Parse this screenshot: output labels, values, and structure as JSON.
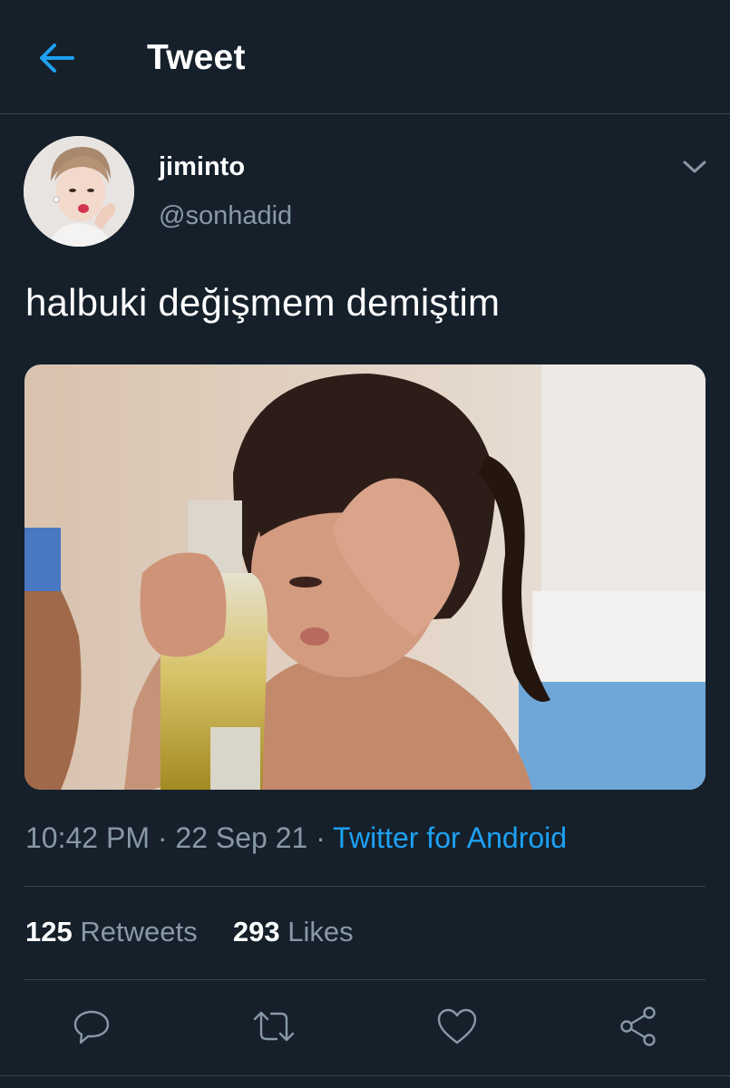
{
  "header": {
    "title": "Tweet",
    "back_icon": "arrow-left-icon",
    "accent_color": "#1da1f2"
  },
  "author": {
    "display_name": "jiminto",
    "handle": "@sonhadid"
  },
  "tweet": {
    "text": "halbuki değişmem demiştim",
    "time": "10:42 PM",
    "separator": " · ",
    "date": "22 Sep 21",
    "source": "Twitter for Android"
  },
  "stats": {
    "retweets_count": "125",
    "retweets_label": "Retweets",
    "likes_count": "293",
    "likes_label": "Likes"
  },
  "actions": [
    "reply-icon",
    "retweet-icon",
    "like-icon",
    "share-icon"
  ],
  "colors": {
    "background": "#15202b",
    "border": "#38444d",
    "secondary_text": "#8899a6",
    "link": "#1da1f2"
  }
}
